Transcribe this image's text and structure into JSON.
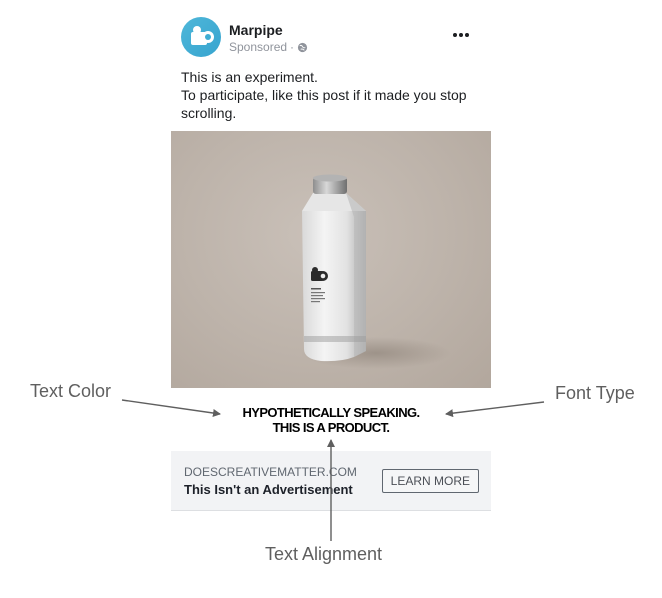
{
  "post": {
    "page_name": "Marpipe",
    "sponsored_label": "Sponsored",
    "privacy_icon": "globe-icon",
    "more_icon": "more-dots-icon",
    "text_lines": [
      "This is an experiment.",
      "To participate, like this post if it made you stop",
      "scrolling."
    ],
    "image_alt": "White product bottle",
    "headline_lines": [
      "HYPOTHETICALLY SPEAKING.",
      "THIS IS A PRODUCT."
    ]
  },
  "cta": {
    "domain": "DOESCREATIVEMATTER.COM",
    "title": "This Isn't an Advertisement",
    "button_label": "LEARN MORE"
  },
  "annotations": {
    "text_color": "Text Color",
    "font_type": "Font Type",
    "text_alignment": "Text Alignment"
  },
  "colors": {
    "avatar": "#36a4cf",
    "image_bg": "#bdb3aa",
    "cta_bg": "#f2f3f5"
  }
}
